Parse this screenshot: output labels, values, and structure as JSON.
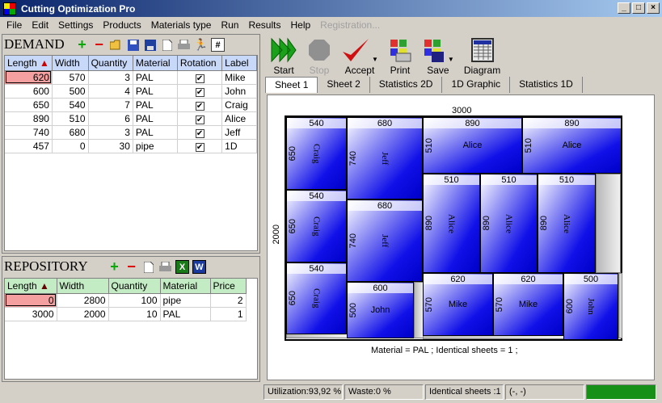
{
  "window": {
    "title": "Cutting Optimization Pro",
    "min": "_",
    "max": "□",
    "close": "×"
  },
  "menu": [
    {
      "label": "File"
    },
    {
      "label": "Edit"
    },
    {
      "label": "Settings"
    },
    {
      "label": "Products"
    },
    {
      "label": "Materials type"
    },
    {
      "label": "Run"
    },
    {
      "label": "Results"
    },
    {
      "label": "Help"
    },
    {
      "label": "Registration...",
      "disabled": true
    }
  ],
  "demand": {
    "title": "DEMAND",
    "columns": [
      "Length",
      "Width",
      "Quantity",
      "Material",
      "Rotation",
      "Label"
    ],
    "sort_indicator": "▲",
    "rows": [
      [
        "620",
        "570",
        "3",
        "PAL",
        "✔",
        "Mike"
      ],
      [
        "600",
        "500",
        "4",
        "PAL",
        "✔",
        "John"
      ],
      [
        "650",
        "540",
        "7",
        "PAL",
        "✔",
        "Craig"
      ],
      [
        "890",
        "510",
        "6",
        "PAL",
        "✔",
        "Alice"
      ],
      [
        "740",
        "680",
        "3",
        "PAL",
        "✔",
        "Jeff"
      ],
      [
        "457",
        "0",
        "30",
        "pipe",
        "✔",
        "1D"
      ]
    ]
  },
  "repository": {
    "title": "REPOSITORY",
    "columns": [
      "Length",
      "Width",
      "Quantity",
      "Material",
      "Price"
    ],
    "sort_indicator": "▲",
    "rows": [
      [
        "0",
        "2800",
        "100",
        "pipe",
        "2"
      ],
      [
        "3000",
        "2000",
        "10",
        "PAL",
        "1"
      ]
    ]
  },
  "toolbar": {
    "start": "Start",
    "stop": "Stop",
    "accept": "Accept",
    "print": "Print",
    "save": "Save",
    "diagram": "Diagram"
  },
  "tabs": [
    "Sheet 1",
    "Sheet 2",
    "Statistics 2D",
    "1D Graphic",
    "Statistics 1D"
  ],
  "sheet": {
    "width_label": "3000",
    "height_label": "2000",
    "footer": "Material = PAL ; Identical sheets  = 1 ;",
    "pieces": [
      {
        "w": "540",
        "h": "650",
        "label": "Craig"
      },
      {
        "w": "680",
        "h": "740",
        "label": "Jeff"
      },
      {
        "w": "890",
        "h": "510",
        "label": "Alice"
      },
      {
        "w": "890",
        "h": "510",
        "label": "Alice"
      },
      {
        "w": "540",
        "h": "650",
        "label": "Craig"
      },
      {
        "w": "510",
        "h": "890",
        "label": "Alice"
      },
      {
        "w": "510",
        "h": "890",
        "label": "Alice"
      },
      {
        "w": "510",
        "h": "890",
        "label": "Alice"
      },
      {
        "w": "680",
        "h": "740",
        "label": "Jeff"
      },
      {
        "w": "540",
        "h": "650",
        "label": "Craig"
      },
      {
        "w": "600",
        "h": "500",
        "label": "John"
      },
      {
        "w": "620",
        "h": "570",
        "label": "Mike"
      },
      {
        "w": "620",
        "h": "570",
        "label": "Mike"
      },
      {
        "w": "500",
        "h": "600",
        "label": "John"
      }
    ]
  },
  "status": {
    "utilization": "Utilization:93,92 %",
    "waste": "Waste:0 %",
    "identical": "Identical sheets :1",
    "coords": "(-, -)"
  },
  "colors": {
    "piece": "#1010e8",
    "progress": "#169016",
    "demand_header": "#c8d8f8",
    "repository_header": "#c4ecc4"
  }
}
